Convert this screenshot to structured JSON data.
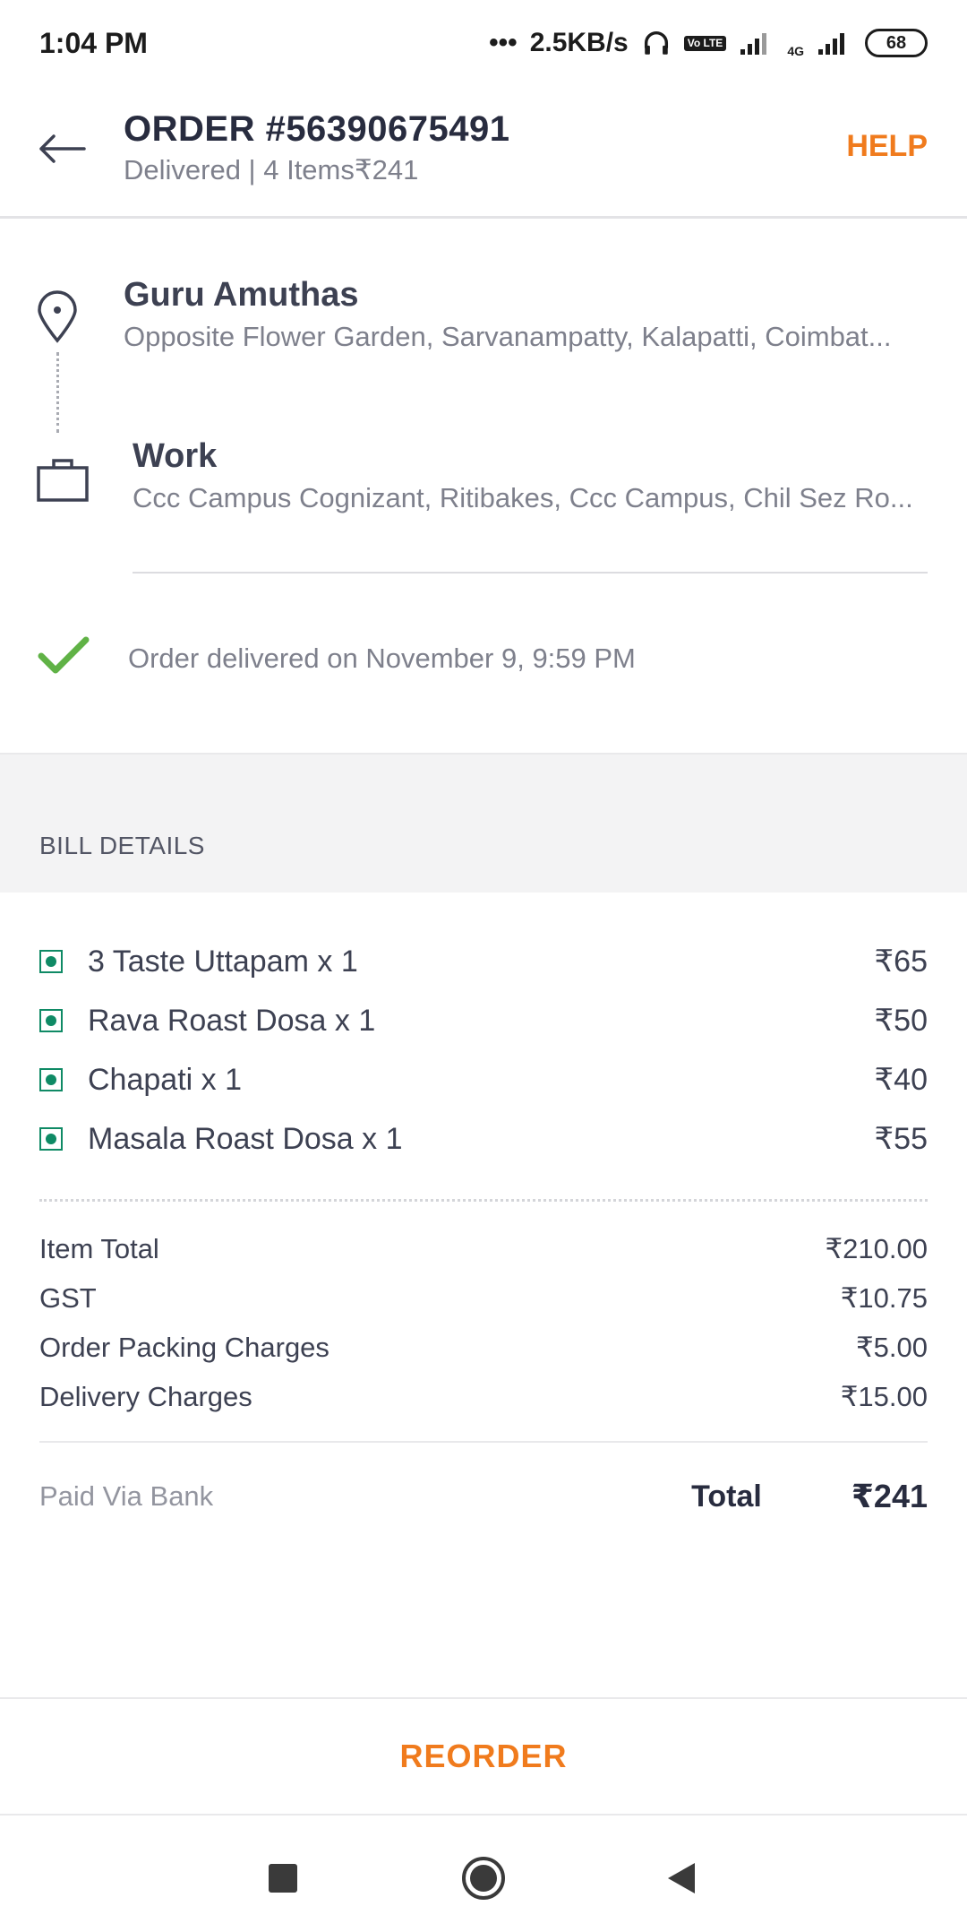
{
  "status_bar": {
    "time": "1:04 PM",
    "network_speed": "2.5KB/s",
    "volte": "Vo LTE",
    "network_type": "4G",
    "battery": "68"
  },
  "header": {
    "title": "ORDER #56390675491",
    "subtitle": "Delivered | 4 Items₹241",
    "help_label": "HELP"
  },
  "restaurant": {
    "name": "Guru Amuthas",
    "address": "Opposite Flower Garden, Sarvanampatty, Kalapatti, Coimbat..."
  },
  "delivery": {
    "name": "Work",
    "address": "Ccc Campus Cognizant, Ritibakes, Ccc Campus, Chil Sez Ro..."
  },
  "status": {
    "text": "Order delivered on November 9, 9:59 PM"
  },
  "bill": {
    "header": "BILL DETAILS",
    "items": [
      {
        "name": "3 Taste Uttapam x 1",
        "price": "₹65"
      },
      {
        "name": "Rava Roast Dosa x 1",
        "price": "₹50"
      },
      {
        "name": "Chapati x 1",
        "price": "₹40"
      },
      {
        "name": "Masala Roast Dosa x 1",
        "price": "₹55"
      }
    ],
    "charges": [
      {
        "label": "Item Total",
        "value": "₹210.00"
      },
      {
        "label": "GST",
        "value": "₹10.75"
      },
      {
        "label": "Order Packing Charges",
        "value": "₹5.00"
      },
      {
        "label": "Delivery Charges",
        "value": "₹15.00"
      }
    ],
    "paid_via": "Paid Via Bank",
    "total_label": "Total",
    "total_value": "₹241"
  },
  "reorder_label": "REORDER",
  "colors": {
    "accent": "#f07b1d",
    "veg": "#0f8a65",
    "check": "#60b246"
  }
}
